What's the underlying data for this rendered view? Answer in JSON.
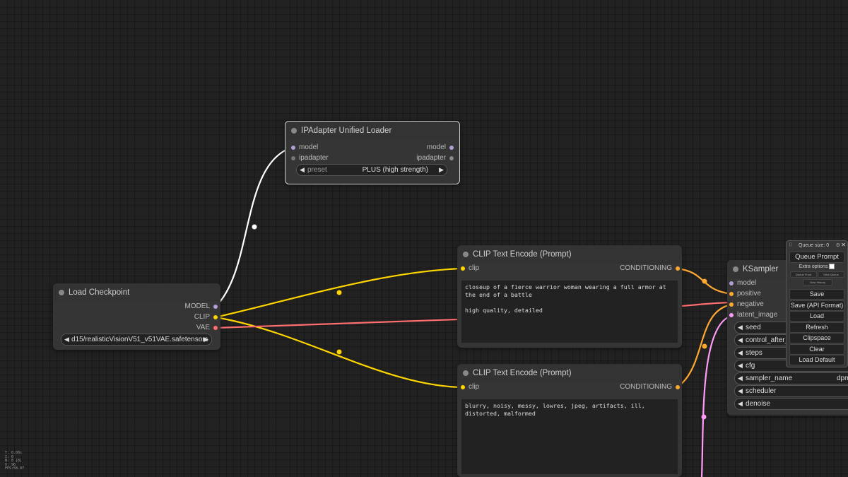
{
  "nodes": {
    "ipadapter": {
      "title": "IPAdapter Unified Loader",
      "inputs": [
        "model",
        "ipadapter"
      ],
      "outputs": [
        "model",
        "ipadapter"
      ],
      "preset_label": "preset",
      "preset_value": "PLUS (high strength)"
    },
    "load_checkpoint": {
      "title": "Load Checkpoint",
      "outputs": [
        "MODEL",
        "CLIP",
        "VAE"
      ],
      "ckpt_name": "d15/realisticVisionV51_v51VAE.safetensors"
    },
    "clip_positive": {
      "title": "CLIP Text Encode (Prompt)",
      "input": "clip",
      "output": "CONDITIONING",
      "text": "closeup of a fierce warrior woman wearing a full armor at the end of a battle\n\nhigh quality, detailed"
    },
    "clip_negative": {
      "title": "CLIP Text Encode (Prompt)",
      "input": "clip",
      "output": "CONDITIONING",
      "text": "blurry, noisy, messy, lowres, jpeg, artifacts, ill, distorted, malformed"
    },
    "ksampler": {
      "title": "KSampler",
      "inputs": [
        "model",
        "positive",
        "negative",
        "latent_image"
      ],
      "widgets": [
        "seed",
        "control_after_",
        "steps",
        "cfg",
        "sampler_name",
        "scheduler",
        "denoise"
      ],
      "sampler_value": "dpm"
    }
  },
  "queue_panel": {
    "queue_size": "Queue size: 0",
    "queue_prompt": "Queue Prompt",
    "extra_options": "Extra options",
    "queue_front": "Queue Front",
    "view_queue": "View Queue",
    "view_history": "View History",
    "buttons": [
      "Save",
      "Save (API Format)",
      "Load",
      "Refresh",
      "Clipspace",
      "Clear",
      "Load Default"
    ]
  },
  "stats": [
    "T: 0.00s",
    "I: 0",
    "N: 8 [8]",
    "V: 96",
    "FPS:58.87"
  ],
  "colors": {
    "model": "#b39ddb",
    "clip": "#ffd500",
    "vae": "#ff6e6e",
    "conditioning": "#ffa931",
    "latent": "#ff9cf9"
  }
}
